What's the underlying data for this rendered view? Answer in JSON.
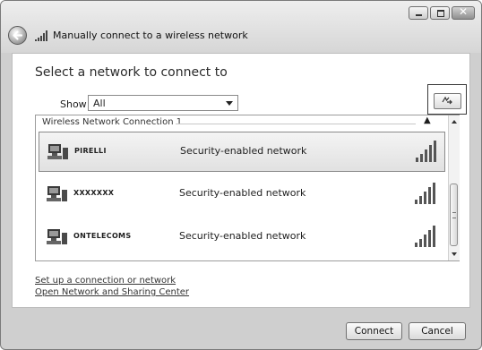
{
  "window": {
    "title": "Manually connect to a wireless network",
    "controls": {
      "minimize": "",
      "maximize": "",
      "close": "✕"
    }
  },
  "main": {
    "heading": "Select a network to connect to",
    "show_label": "Show",
    "show_selected": "All",
    "group_header": "Wireless Network Connection 1",
    "networks": [
      {
        "name": "PIRELLI",
        "security": "Security-enabled network",
        "selected": true
      },
      {
        "name": "XXXXXXX",
        "security": "Security-enabled network",
        "selected": false
      },
      {
        "name": "ONTELECOMS",
        "security": "Security-enabled network",
        "selected": false
      }
    ],
    "links": {
      "setup": "Set up a connection or network",
      "sharing_center": "Open Network and Sharing Center"
    }
  },
  "footer": {
    "connect": "Connect",
    "cancel": "Cancel"
  },
  "icons": {
    "back": "back-arrow-icon",
    "title": "wireless-signal-icon",
    "refresh": "refresh-icon",
    "network": "network-computer-icon",
    "signal": "signal-strength-icon"
  }
}
